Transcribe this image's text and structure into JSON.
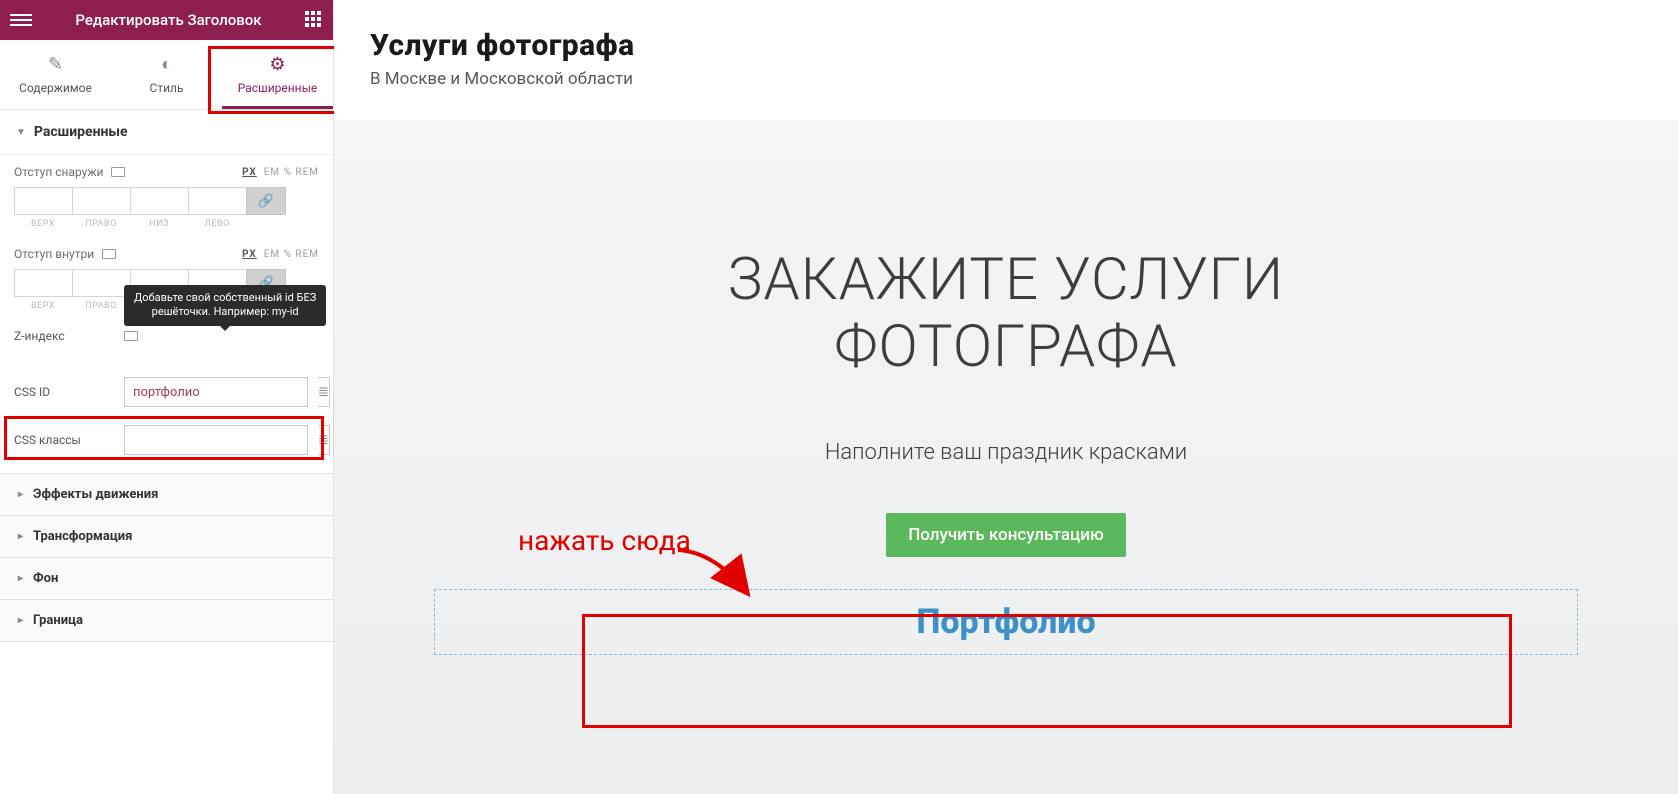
{
  "panel": {
    "header_title": "Редактировать Заголовок",
    "tabs": {
      "content": "Содержимое",
      "style": "Стиль",
      "advanced": "Расширенные"
    },
    "section_advanced": "Расширенные",
    "margin": {
      "label": "Отступ снаружи",
      "units_active": "PX",
      "units_rest": "EM  %  REM",
      "top": "ВЕРХ",
      "right": "ПРАВО",
      "bottom": "НИЗ",
      "left": "ЛЕВО"
    },
    "padding": {
      "label": "Отступ внутри",
      "units_active": "PX",
      "units_rest": "EM  %  REM"
    },
    "zindex": {
      "label": "Z-индекс"
    },
    "tooltip_line1": "Добавьте свой собственный id БЕЗ",
    "tooltip_line2": "решёточки. Например: my-id",
    "css_id": {
      "label": "CSS ID",
      "value": "портфолио"
    },
    "css_classes": {
      "label": "CSS классы",
      "value": ""
    },
    "accordion": {
      "motion": "Эффекты движения",
      "transform": "Трансформация",
      "background": "Фон",
      "border": "Граница"
    }
  },
  "preview": {
    "title": "Услуги фотографа",
    "subtitle": "В Москве и Московской области",
    "hero_line1": "ЗАКАЖИТЕ УСЛУГИ",
    "hero_line2": "ФОТОГРАФА",
    "hero_sub": "Наполните ваш праздник красками",
    "cta": "Получить консультацию",
    "portfolio": "Портфолио"
  },
  "annotation": {
    "click_here": "нажать сюда"
  }
}
